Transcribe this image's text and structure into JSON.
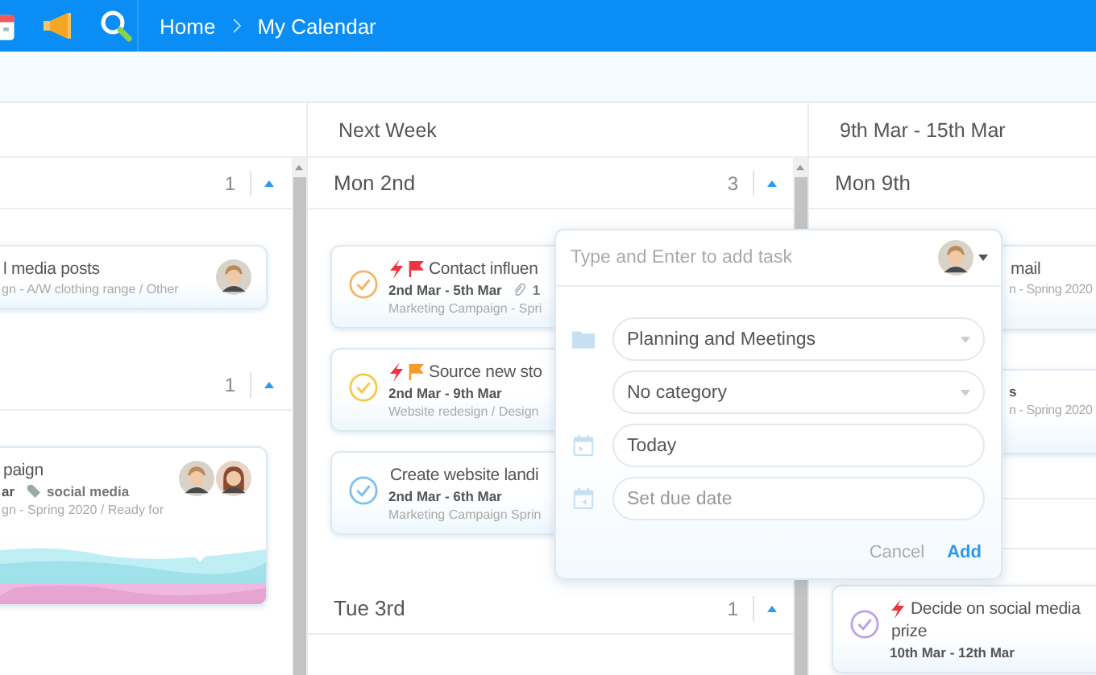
{
  "topbar": {
    "breadcrumb": [
      "Home",
      "My Calendar"
    ]
  },
  "columns": [
    {
      "days": [
        {
          "count": "1",
          "tasks": [
            {
              "title": "l media posts",
              "meta": "gn - A/W clothing range / Other",
              "assignees": [
                {
                  "kind": "man"
                }
              ]
            }
          ]
        },
        {
          "count": "1",
          "tasks": [
            {
              "title": "paign",
              "tag_prefix": "ar",
              "tags": [
                "social media"
              ],
              "meta": "gn - Spring 2020 / Ready for",
              "assignees": [
                {
                  "kind": "man"
                },
                {
                  "kind": "woman"
                }
              ],
              "cover": {
                "kind": "picture"
              }
            }
          ]
        }
      ]
    },
    {
      "title": "Next Week",
      "days": [
        {
          "label": "Mon 2nd",
          "count": "3",
          "tasks": [
            {
              "title": "Contact influen",
              "color": "#f5b56b",
              "flags": [
                {
                  "kind": "lightning",
                  "color": "#ef3340"
                },
                {
                  "kind": "flag",
                  "color": "#ef3340"
                }
              ],
              "dates": "2nd Mar - 5th Mar",
              "attachments": "1",
              "meta": "Marketing Campaign - Spri"
            },
            {
              "title": "Source new sto",
              "color": "#f7c94a",
              "flags": [
                {
                  "kind": "lightning",
                  "color": "#ef3340"
                },
                {
                  "kind": "flag",
                  "color": "#f59a2c"
                }
              ],
              "dates": "2nd Mar - 9th Mar",
              "meta": "Website redesign / Design"
            },
            {
              "title": "Create website landi",
              "color": "#7ec0ee",
              "dates": "2nd Mar - 6th Mar",
              "meta": "Marketing Campaign Sprin"
            }
          ]
        },
        {
          "label": "Tue 3rd",
          "count": "1"
        }
      ]
    },
    {
      "title": "9th Mar - 15th Mar",
      "days": [
        {
          "label": "Mon 9th",
          "tasks": [
            {
              "title": "mail",
              "meta": "n - Spring 2020"
            },
            {
              "dates": "s",
              "meta": "n - Spring 2020"
            }
          ]
        },
        {
          "tasks": [
            {
              "title": "Decide on social media",
              "title_2": "prize",
              "color": "#b9a3ee",
              "flags": [
                {
                  "kind": "lightning",
                  "color": "#ef3340"
                }
              ],
              "dates": "10th Mar - 12th Mar"
            }
          ]
        }
      ]
    }
  ],
  "popup": {
    "input": {
      "placeholder": "Type and Enter to add task"
    },
    "fields": [
      {
        "kind": "project",
        "value": "Planning and Meetings"
      },
      {
        "kind": "category",
        "value": "No category"
      },
      {
        "kind": "start",
        "value": "Today"
      },
      {
        "kind": "due",
        "placeholder": "Set due date"
      }
    ],
    "buttons": [
      {
        "label": "Cancel",
        "kind": "secondary"
      },
      {
        "label": "Add",
        "kind": "primary"
      }
    ]
  }
}
